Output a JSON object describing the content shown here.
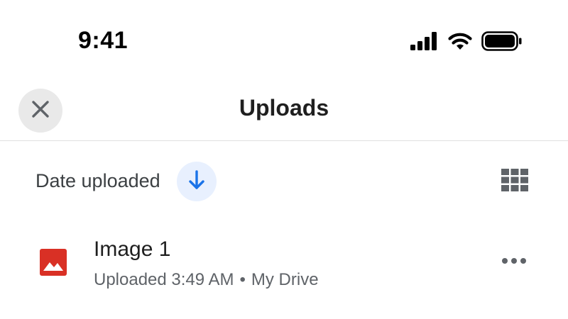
{
  "status_bar": {
    "time": "9:41",
    "icons": [
      "cellular-signal-icon",
      "wifi-icon",
      "battery-icon"
    ]
  },
  "app_bar": {
    "title": "Uploads",
    "close_icon": "close-icon"
  },
  "sort": {
    "label": "Date uploaded",
    "direction_icon": "arrow-down-icon",
    "view_toggle_icon": "grid-view-icon"
  },
  "files": [
    {
      "name": "Image 1",
      "uploaded": "Uploaded 3:49 AM",
      "separator": "•",
      "location": "My Drive",
      "type_icon": "image-file-icon",
      "more_icon": "more-horizontal-icon"
    }
  ],
  "colors": {
    "accent_blue": "#1a73e8",
    "accent_blue_bg": "#e8f0fe",
    "image_file_red": "#d93025",
    "close_bg": "#e9e9e9",
    "grid_icon": "#5f6368"
  }
}
